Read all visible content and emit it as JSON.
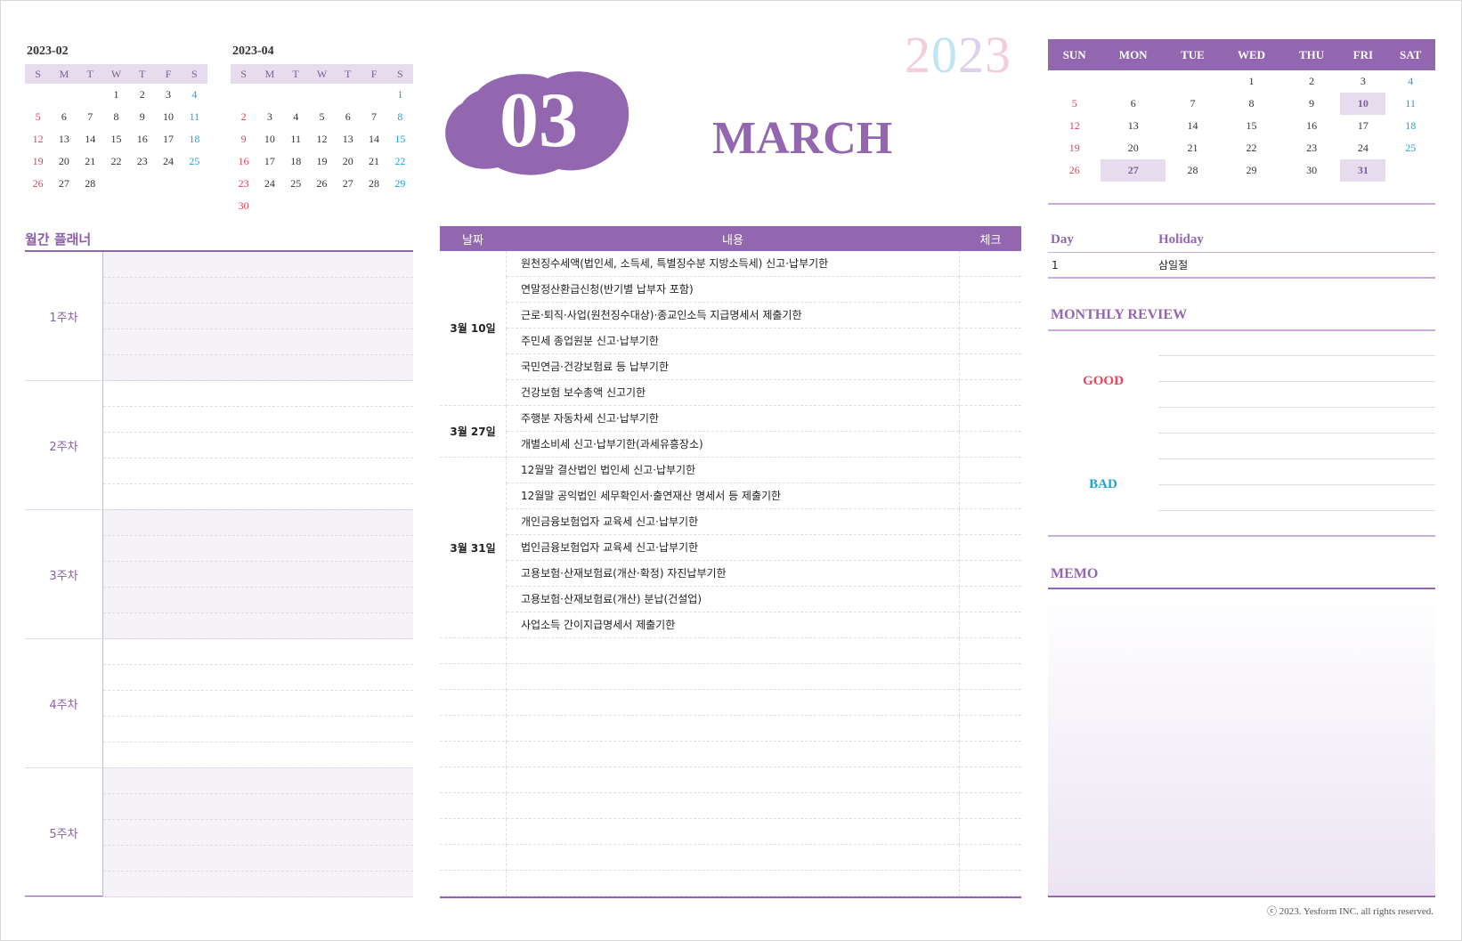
{
  "mini_prev": {
    "title": "2023-02",
    "days": [
      "S",
      "M",
      "T",
      "W",
      "T",
      "F",
      "S"
    ],
    "weeks": [
      [
        "",
        "",
        "",
        "1",
        "2",
        "3",
        "4"
      ],
      [
        "5",
        "6",
        "7",
        "8",
        "9",
        "10",
        "11"
      ],
      [
        "12",
        "13",
        "14",
        "15",
        "16",
        "17",
        "18"
      ],
      [
        "19",
        "20",
        "21",
        "22",
        "23",
        "24",
        "25"
      ],
      [
        "26",
        "27",
        "28",
        "",
        "",
        "",
        ""
      ]
    ]
  },
  "mini_next": {
    "title": "2023-04",
    "days": [
      "S",
      "M",
      "T",
      "W",
      "T",
      "F",
      "S"
    ],
    "weeks": [
      [
        "",
        "",
        "",
        "",
        "",
        "",
        "1"
      ],
      [
        "2",
        "3",
        "4",
        "5",
        "6",
        "7",
        "8"
      ],
      [
        "9",
        "10",
        "11",
        "12",
        "13",
        "14",
        "15"
      ],
      [
        "16",
        "17",
        "18",
        "19",
        "20",
        "21",
        "22"
      ],
      [
        "23",
        "24",
        "25",
        "26",
        "27",
        "28",
        "29"
      ],
      [
        "30",
        "",
        "",
        "",
        "",
        "",
        ""
      ]
    ]
  },
  "planner": {
    "title": "월간 플래너",
    "weeks": [
      "1주차",
      "2주차",
      "3주차",
      "4주차",
      "5주차"
    ]
  },
  "hero": {
    "month_number": "03",
    "year": "2023",
    "month_name": "MARCH",
    "blob_color": "#9366b0"
  },
  "schedule": {
    "headers": {
      "date": "날짜",
      "content": "내용",
      "check": "체크"
    },
    "groups": [
      {
        "date": "3월 10일",
        "items": [
          "원천징수세액(법인세, 소득세, 특별징수분 지방소득세) 신고·납부기한",
          "연말정산환급신청(반기별 납부자 포함)",
          "근로·퇴직·사업(원천징수대상)·종교인소득 지급명세서 제출기한",
          "주민세 종업원분 신고·납부기한",
          "국민연금·건강보험료 등 납부기한",
          "건강보험 보수총액 신고기한"
        ]
      },
      {
        "date": "3월 27일",
        "items": [
          "주행분 자동차세 신고·납부기한",
          "개별소비세 신고·납부기한(과세유흥장소)"
        ]
      },
      {
        "date": "3월 31일",
        "items": [
          "12월말 결산법인 법인세 신고·납부기한",
          "12월말 공익법인 세무확인서·출연재산 명세서 등 제출기한",
          "개인금융보험업자 교육세 신고·납부기한",
          "법인금융보험업자 교육세 신고·납부기한",
          "고용보험·산재보험료(개산·확정) 자진납부기한",
          "고용보험·산재보험료(개산) 분납(건설업)",
          "사업소득 간이지급명세서 제출기한"
        ]
      }
    ]
  },
  "calendar": {
    "days": [
      "SUN",
      "MON",
      "TUE",
      "WED",
      "THU",
      "FRI",
      "SAT"
    ],
    "weeks": [
      [
        "",
        "",
        "",
        "1",
        "2",
        "3",
        "4"
      ],
      [
        "5",
        "6",
        "7",
        "8",
        "9",
        "10",
        "11"
      ],
      [
        "12",
        "13",
        "14",
        "15",
        "16",
        "17",
        "18"
      ],
      [
        "19",
        "20",
        "21",
        "22",
        "23",
        "24",
        "25"
      ],
      [
        "26",
        "27",
        "28",
        "29",
        "30",
        "31",
        ""
      ]
    ],
    "highlighted": [
      "10",
      "27",
      "31"
    ],
    "accent": "#9366b0",
    "highlight_color": "#e6dcee"
  },
  "holidays": {
    "headers": {
      "day": "Day",
      "holiday": "Holiday"
    },
    "rows": [
      {
        "day": "1",
        "holiday": "삼일절"
      }
    ]
  },
  "review": {
    "title": "MONTHLY REVIEW",
    "good": "GOOD",
    "bad": "BAD",
    "good_color": "#e8455c",
    "bad_color": "#1fa3d6"
  },
  "memo": {
    "title": "MEMO"
  },
  "footer": {
    "copyright": "ⓒ 2023. Yesform INC. all rights reserved."
  }
}
